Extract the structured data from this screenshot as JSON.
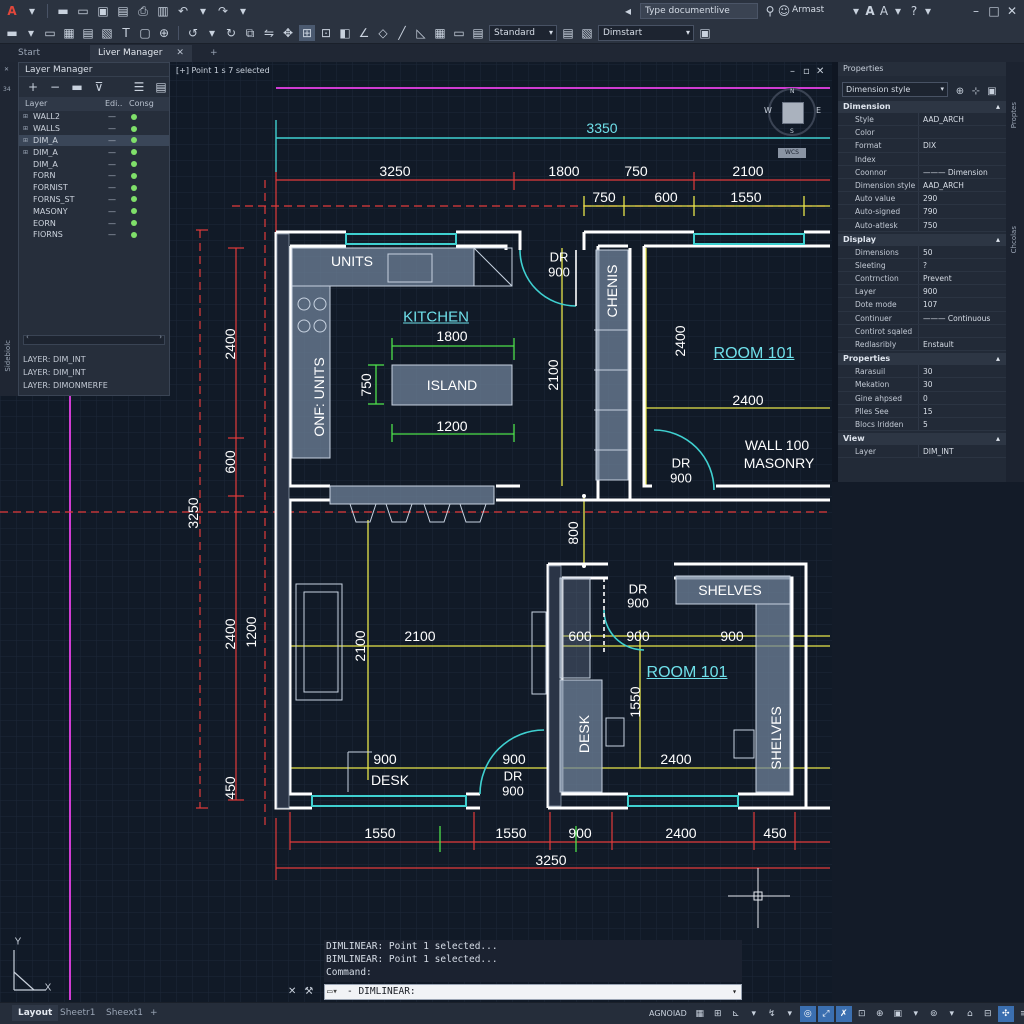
{
  "app": {
    "logo": "A"
  },
  "toolbar": {
    "layer_combo": "Standard",
    "dim_combo": "Dimstart",
    "search_placeholder": "Type documentlive",
    "user_label": "Armast"
  },
  "tabs": [
    {
      "label": "Start"
    },
    {
      "label": "Liver Manager"
    }
  ],
  "viewport": {
    "label": "[+] Point 1 s 7 selected",
    "compass": {
      "n": "N",
      "w": "W",
      "e": "E",
      "s": "S",
      "wcs": "WCS"
    }
  },
  "layer_panel": {
    "title": "Layer Manager",
    "col_layer": "Layer",
    "col_edit": "Edi..",
    "col_const": "Consg",
    "side_number": "34",
    "side_vertical": "Sidebiolc",
    "layers": [
      {
        "name": "WALL2",
        "edit": "—"
      },
      {
        "name": "WALLS",
        "edit": "—"
      },
      {
        "name": "DIM_A",
        "edit": "—",
        "selected": true
      },
      {
        "name": "DIM_A",
        "edit": "—"
      },
      {
        "name": "DIM_A",
        "edit": "—"
      },
      {
        "name": "FORN",
        "edit": "—"
      },
      {
        "name": "FORNIST",
        "edit": "—"
      },
      {
        "name": "FORNS_ST",
        "edit": "—"
      },
      {
        "name": "MASONY",
        "edit": "—"
      },
      {
        "name": "EORN",
        "edit": "—"
      },
      {
        "name": "FIORNS",
        "edit": "—"
      }
    ],
    "info": [
      "LAYER: DIM_INT",
      "LAYER: DIM_INT",
      "LAYER: DIMONMERFE"
    ]
  },
  "drawing": {
    "rooms": {
      "units": "UNITS",
      "kitchen": "KITCHEN",
      "island": "ISLAND",
      "onf_units": "ONF: UNITS",
      "chenis": "CHENIS",
      "room101_a": "ROOM 101",
      "room101_b": "ROOM 101",
      "wall100": "WALL 100",
      "masonry": "MASONRY",
      "shelves_h": "SHELVES",
      "shelves_v": "SHELVES",
      "desk_v": "DESK",
      "desk_h": "DESK",
      "dr_a": "DR",
      "dr_a_val": "900",
      "dr_b": "DR",
      "dr_b_val": "900",
      "dr_c": "DR",
      "dr_c_val": "900",
      "dr_d": "DR",
      "dr_d_val": "900"
    },
    "dims": {
      "top_total": "3350",
      "top_1": "3250",
      "top_2": "1800",
      "top_3": "750",
      "top_4": "2100",
      "top2_1": "750",
      "top2_2": "600",
      "top2_3": "1550",
      "island_w": "1800",
      "island_w2": "1200",
      "island_h": "750",
      "left_1": "2400",
      "left_2": "600",
      "left_3": "3250",
      "left_4": "2400",
      "left_5": "1200",
      "left_6": "450",
      "mid_2100v": "2100",
      "mid_2400v": "2400",
      "mid_2400h": "2400",
      "mid_800": "800",
      "lower_2100h": "2100",
      "lower_2100v": "2100",
      "lower_600": "600",
      "lower_900a": "900",
      "lower_900b": "900",
      "lower_1550v": "1550",
      "lower_2400": "2400",
      "lower_900c": "900",
      "lower_900d": "900",
      "bot_1550a": "1550",
      "bot_1550b": "1550",
      "bot_900": "900",
      "bot_2400": "2400",
      "bot_450": "450",
      "bot_total": "3250"
    },
    "ucs": {
      "y": "Y",
      "x": "X"
    }
  },
  "properties": {
    "title": "Properties",
    "selector": "Dimension style",
    "side_tab_1": "Proptes",
    "side_tab_2": "Chcolas",
    "sections": [
      {
        "name": "Dimension",
        "rows": [
          {
            "k": "Style",
            "v": "AAD_ARCH"
          },
          {
            "k": "Color",
            "v": ""
          },
          {
            "k": "Format",
            "v": "DIX"
          },
          {
            "k": "Index",
            "v": ""
          },
          {
            "k": "Coonnor",
            "v": "——— Dimension"
          },
          {
            "k": "Dimension style",
            "v": "AAD_ARCH"
          },
          {
            "k": "Auto value",
            "v": "290"
          },
          {
            "k": "Auto-signed",
            "v": "790"
          },
          {
            "k": "Auto-atlesk",
            "v": "750"
          }
        ]
      },
      {
        "name": "Display",
        "rows": [
          {
            "k": "Dimensions",
            "v": "50"
          },
          {
            "k": "Sleeting",
            "v": "?"
          },
          {
            "k": "Contrnction",
            "v": "Prevent"
          },
          {
            "k": "Layer",
            "v": "900"
          },
          {
            "k": "Dote mode",
            "v": "107"
          },
          {
            "k": "Continuer",
            "v": "——— Continuous"
          },
          {
            "k": "Contirot sqaled",
            "v": ""
          },
          {
            "k": "Redlasribly",
            "v": "Enstault"
          }
        ]
      },
      {
        "name": "Properties",
        "rows": [
          {
            "k": "Rarasuil",
            "v": "30"
          },
          {
            "k": "Mekation",
            "v": "30"
          },
          {
            "k": "Gine ahpsed",
            "v": "0"
          },
          {
            "k": "Plles See",
            "v": "15"
          },
          {
            "k": "Blocs lridden",
            "v": "5"
          }
        ]
      },
      {
        "name": "View",
        "rows": [
          {
            "k": "Layer",
            "v": "DIM_INT"
          }
        ]
      }
    ]
  },
  "command": {
    "history": [
      "DIMLINEAR: Point 1 selected...",
      "BIMLINEAR: Point 1 selected...",
      "Command:"
    ],
    "prompt": "- DIMLINEAR:"
  },
  "status": {
    "tabs": [
      "Layout",
      "Sheetr1",
      "Sheext1"
    ],
    "add": "+",
    "model_label": "AGNOIAD"
  },
  "colors": {
    "wall": "#ffffff",
    "dim_red": "#e23b3b",
    "dim_yellow": "#e8e54a",
    "dim_green": "#4ee04a",
    "dim_cyan": "#3fd0d0",
    "magenta": "#d13cd3",
    "fixture": "#8fa3bf"
  }
}
